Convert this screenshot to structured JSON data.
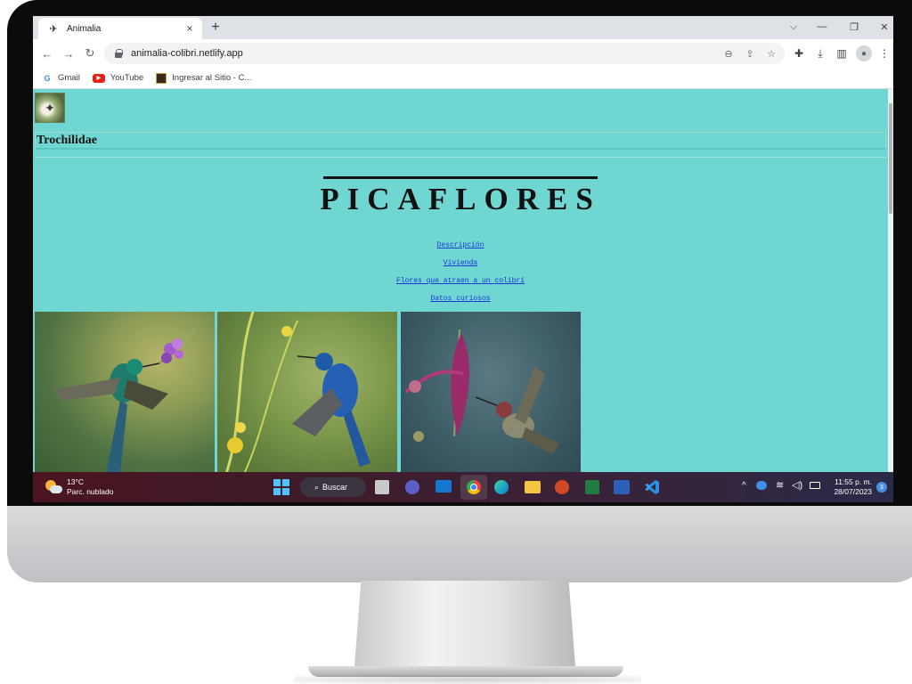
{
  "browser": {
    "tab_title": "Animalia",
    "url": "animalia-colibri.netlify.app",
    "new_tab": "+",
    "close": "×"
  },
  "bookmarks": [
    {
      "label": "Gmail",
      "icon": "google-icon"
    },
    {
      "label": "YouTube",
      "icon": "youtube-icon"
    },
    {
      "label": "Ingresar al Sitio - C...",
      "icon": "site-icon"
    }
  ],
  "page": {
    "brand": "Trochilidae",
    "hero_title": "PICAFLORES",
    "nav": [
      {
        "label": "Descripción"
      },
      {
        "label": "Vivienda"
      },
      {
        "label": "Flores que atraen a un colibrí"
      },
      {
        "label": "Datos curiosos"
      }
    ],
    "photos": [
      {
        "icon": "hummingbird-violet-flower-photo"
      },
      {
        "icon": "hummingbird-blue-yellow-flowers-photo"
      },
      {
        "icon": "hummingbird-purple-flower-photo"
      }
    ],
    "background_color": "#6fd6d2"
  },
  "taskbar": {
    "weather_temp": "13°C",
    "weather_desc": "Parc. nublado",
    "search_label": "Buscar",
    "time": "11:55 p. m.",
    "date": "28/07/2023",
    "notification_count": "3"
  }
}
